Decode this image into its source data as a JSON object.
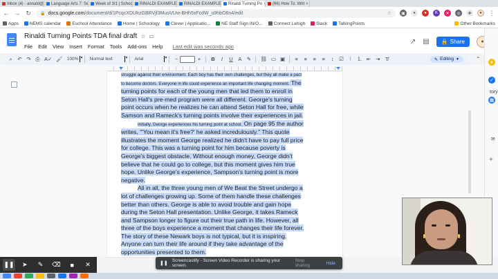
{
  "tabs": [
    {
      "label": "Inbox (4) - annald@",
      "color": "#d93025",
      "active": false
    },
    {
      "label": "Language Arts 7: Se",
      "color": "#1a73e8",
      "active": false
    },
    {
      "label": "Week of 3/1 | Schoo",
      "color": "#1a73e8",
      "active": false
    },
    {
      "label": "RINALDI EXAMPLE",
      "color": "#1a73e8",
      "active": false
    },
    {
      "label": "RINALDI EXAMPLE",
      "color": "#1a73e8",
      "active": false
    },
    {
      "label": "Rinaldi Turning Po",
      "color": "#1a73e8",
      "active": true
    },
    {
      "label": "(66) How To: Writ",
      "color": "#ff0000",
      "active": false
    }
  ],
  "browser": {
    "url_host": "docs.google.com",
    "url_path": "/document/d/1PcqcXDUlrzGBRVjf3MuoVUw-BHh5xFcdW_u9hbO6n4/edit"
  },
  "bookmarks": [
    {
      "label": "Apps",
      "color": "#5f6368"
    },
    {
      "label": "NEMS calendar",
      "color": "#1a73e8"
    },
    {
      "label": "Eschool Attendance",
      "color": "#e37400"
    },
    {
      "label": "Home | Schoology",
      "color": "#1a73e8"
    },
    {
      "label": "Clever | Applicatio...",
      "color": "#1a73e8"
    },
    {
      "label": "NE Staff Sign IN/O...",
      "color": "#188038"
    },
    {
      "label": "Connect Lehigh",
      "color": "#5f6368"
    },
    {
      "label": "Slack",
      "color": "#e01e5a"
    },
    {
      "label": "TalkingPoints",
      "color": "#1a73e8"
    }
  ],
  "bookmarks_other": "Other Bookmarks",
  "docs": {
    "title": "Rinaldi Turning Points TDA final draft",
    "menu": [
      "File",
      "Edit",
      "View",
      "Insert",
      "Format",
      "Tools",
      "Add-ons",
      "Help"
    ],
    "last_edit": "Last edit was seconds ago",
    "share_label": "Share"
  },
  "toolbar": {
    "zoom": "100%",
    "style": "Normal text",
    "font": "Arial",
    "mode": "Editing"
  },
  "document_lines": [
    {
      "text": "struggle against their environment. Each boy has their own challenges, but they all make a pact",
      "small": true,
      "hl": true
    },
    {
      "text": "to become doctors. Everyone in life could experience an important life changing moment.",
      "small": true,
      "hl": true,
      "tail": " The"
    },
    {
      "text": "turning points for each of the young men that led them to enroll in",
      "hl": true
    },
    {
      "text": "Seton Hall's pre-med program were all different. George's turning",
      "hl": true
    },
    {
      "text": "point occurs when he realizes he can attend Seton Hall for free, while",
      "hl": true
    },
    {
      "text": "Samson and Rameck's turning points involve their experiences in jail.",
      "hl": true
    },
    {
      "text": "Initially, George experiences his turning point at school.",
      "small": true,
      "hl": true,
      "indent": true,
      "tail": " On page 95 the author"
    },
    {
      "text": "writes, \"'You mean it's free?' he asked incredulously.\" This quote",
      "hl": true
    },
    {
      "text": "illustrates the moment George realized he didn't have to pay full price",
      "hl": true
    },
    {
      "text": "for college. This was a turning point for him because poverty is",
      "hl": true
    },
    {
      "text": "George's biggest obstacle. Without enough money, George didn't",
      "hl": true
    },
    {
      "text": "believe that he could go to college, but this moment gives him true",
      "hl": true
    },
    {
      "text": "hope. Unlike George's experience, Sampson's turning point is more",
      "hl": true
    },
    {
      "text": "negative.",
      "hl": true
    },
    {
      "text": "All in all, the three young men of We Beat the Street undergo a",
      "hl": true,
      "indent": true
    },
    {
      "text": "lot of challenges growing up. Some of them handle these challenges",
      "hl": true
    },
    {
      "text": "better than others. George is able to avoid trouble and gain hope",
      "hl": true
    },
    {
      "text": "during the Seton Hall presentation. Unlike George, it takes Rameck",
      "hl": true
    },
    {
      "text": "and Sampson longer to figure out their true path in life. However, all",
      "hl": true
    },
    {
      "text": "three of the boys experience a moment that changes their life forever.",
      "hl": true
    },
    {
      "text": "The story of these Newark boys is not typical, but it is inspiring.",
      "hl": true
    },
    {
      "text": "Anyone can turn their life around if they take advantage of the",
      "hl": true
    },
    {
      "text": "opportunities presented to them.",
      "hl": true
    }
  ],
  "right_edge": {
    "text1": "tory",
    "text2": "te"
  },
  "screencastify": {
    "message": "Screencastify - Screen Video Recorder is sharing your screen.",
    "stop_label": "Stop sharing",
    "hide_label": "Hide"
  }
}
